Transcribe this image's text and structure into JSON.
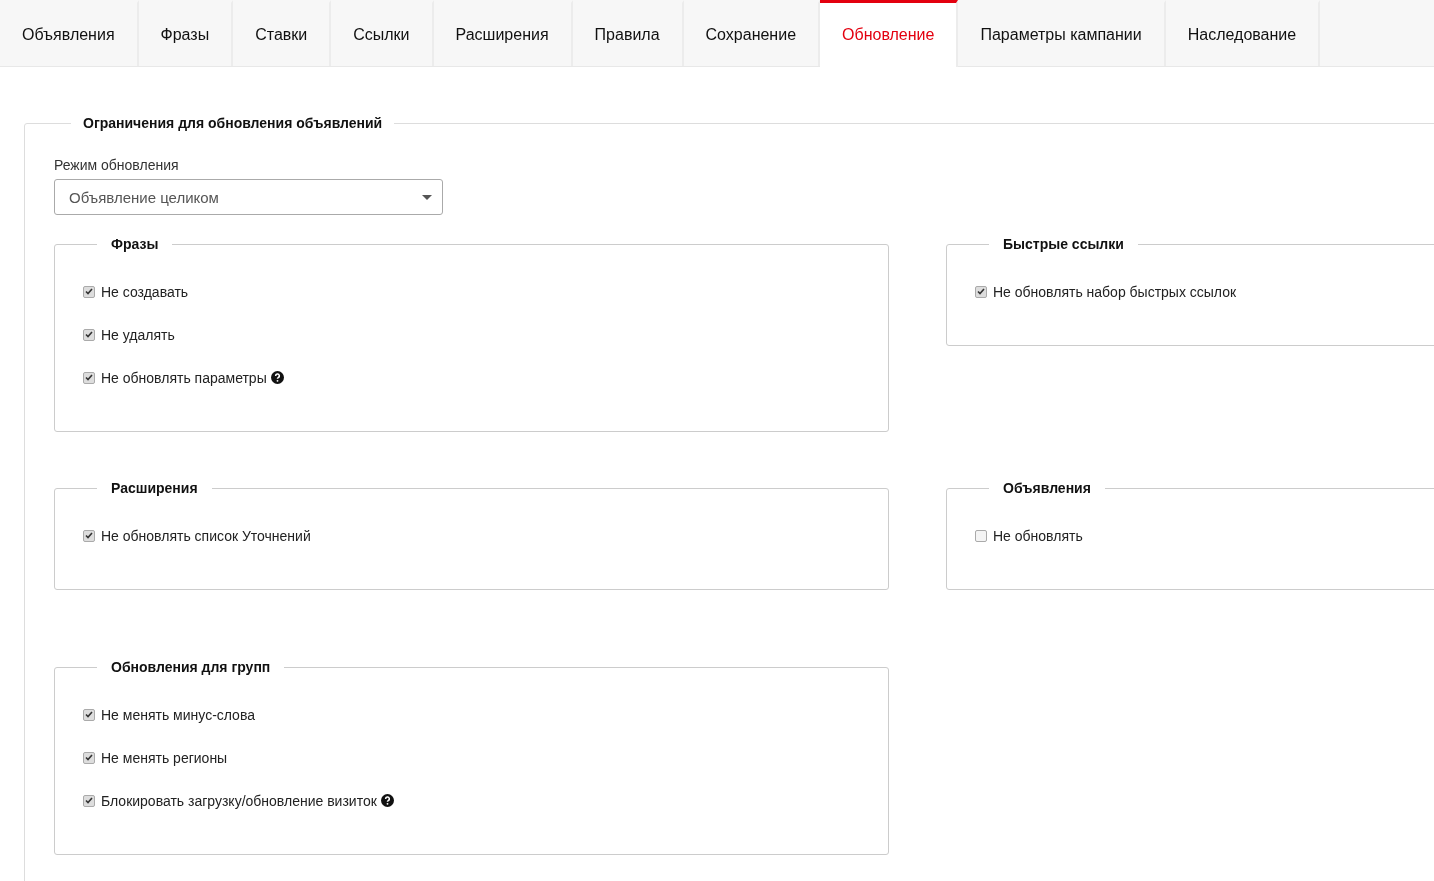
{
  "tabs": [
    {
      "label": "Объявления",
      "selected": false
    },
    {
      "label": "Фразы",
      "selected": false
    },
    {
      "label": "Ставки",
      "selected": false
    },
    {
      "label": "Ссылки",
      "selected": false
    },
    {
      "label": "Расширения",
      "selected": false
    },
    {
      "label": "Правила",
      "selected": false
    },
    {
      "label": "Сохранение",
      "selected": false
    },
    {
      "label": "Обновление",
      "selected": true
    },
    {
      "label": "Параметры кампании",
      "selected": false
    },
    {
      "label": "Наследование",
      "selected": false
    }
  ],
  "section": {
    "title": "Ограничения для обновления объявлений",
    "mode_label": "Режим обновления",
    "mode_value": "Объявление целиком",
    "rows": [
      [
        {
          "title": "Фразы",
          "options": [
            {
              "label": "Не создавать",
              "checked": true,
              "help": false
            },
            {
              "label": "Не удалять",
              "checked": true,
              "help": false
            },
            {
              "label": "Не обновлять параметры",
              "checked": true,
              "help": true
            }
          ]
        },
        {
          "title": "Быстрые ссылки",
          "options": [
            {
              "label": "Не обновлять набор быстрых ссылок",
              "checked": true,
              "help": false
            }
          ]
        }
      ],
      [
        {
          "title": "Расширения",
          "options": [
            {
              "label": "Не обновлять список Уточнений",
              "checked": true,
              "help": false
            }
          ]
        },
        {
          "title": "Объявления",
          "options": [
            {
              "label": "Не обновлять",
              "checked": false,
              "help": false
            }
          ]
        }
      ],
      [
        {
          "title": "Обновления для групп",
          "options": [
            {
              "label": "Не менять минус-слова",
              "checked": true,
              "help": false
            },
            {
              "label": "Не менять регионы",
              "checked": true,
              "help": false
            },
            {
              "label": "Блокировать загрузку/обновление визиток",
              "checked": true,
              "help": true
            }
          ]
        }
      ]
    ]
  }
}
